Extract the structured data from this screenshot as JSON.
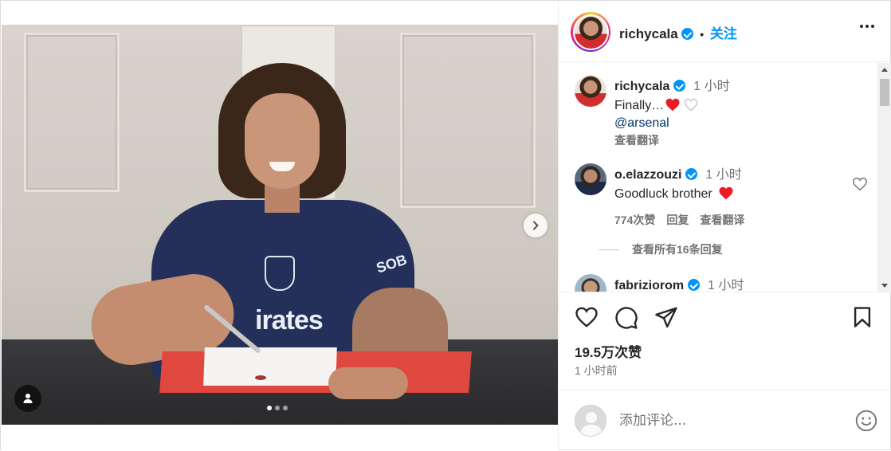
{
  "post": {
    "username": "richycala",
    "separator": "•",
    "follow_label": "关注",
    "likes": "19.5万次赞",
    "time_ago": "1 小时前",
    "carousel": {
      "slides": 3,
      "active": 0
    }
  },
  "comments": [
    {
      "username": "richycala",
      "time": "1 小时",
      "text": "Finally…",
      "mention": "@arsenal",
      "translate": "查看翻译"
    },
    {
      "username": "o.elazzouzi",
      "time": "1 小时",
      "text": "Goodluck brother",
      "likes": "774次赞",
      "reply": "回复",
      "translate": "查看翻译"
    },
    {
      "username": "fabriziorom",
      "time": "1 小时"
    }
  ],
  "view_replies": "查看所有16条回复",
  "add_comment": {
    "placeholder": "添加评论..."
  },
  "photo": {
    "sponsor_text": "irates",
    "sleeve_text": "SOB"
  },
  "colors": {
    "accent": "#0095f6",
    "heart": "#ed1c24",
    "text": "#262626",
    "muted": "#737373"
  },
  "icons": [
    "chevron-right-icon",
    "user-tag-icon",
    "verified-icon",
    "more-icon",
    "heart-icon",
    "comment-icon",
    "share-icon",
    "bookmark-icon",
    "emoji-icon"
  ]
}
